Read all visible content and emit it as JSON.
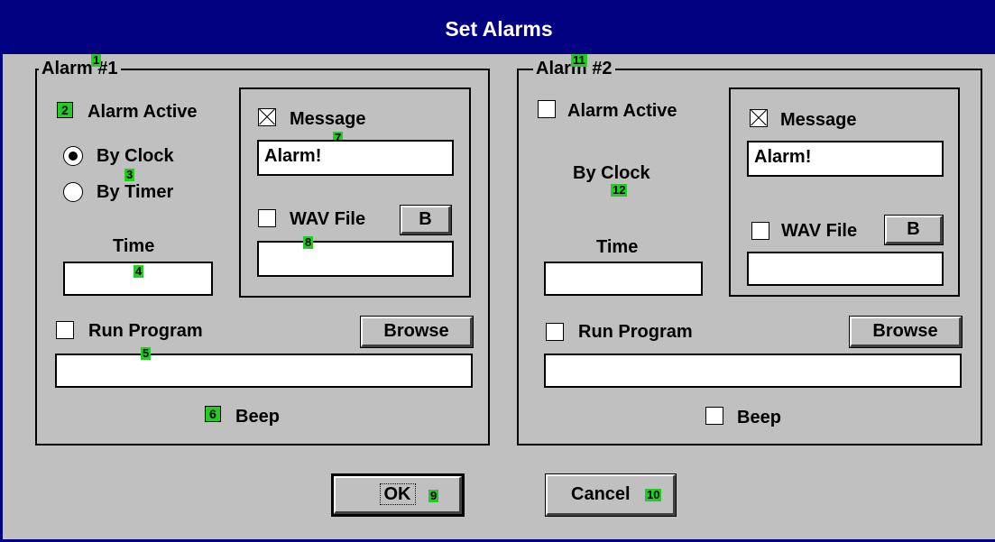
{
  "window": {
    "title": "Set Alarms"
  },
  "alarm1": {
    "group_label": "Alarm #1",
    "alarm_active_label": "Alarm Active",
    "by_clock_label": "By Clock",
    "by_timer_label": "By Timer",
    "time_label": "Time",
    "time_value": "",
    "message_label": "Message",
    "message_value": "Alarm!",
    "wav_file_label": "WAV File",
    "wav_browse_label": "B",
    "wav_value": "",
    "run_program_label": "Run Program",
    "browse_label": "Browse",
    "program_value": "",
    "beep_label": "Beep"
  },
  "alarm2": {
    "group_label": "Alarm #2",
    "alarm_active_label": "Alarm Active",
    "by_clock_label": "By Clock",
    "time_label": "Time",
    "time_value": "",
    "message_label": "Message",
    "message_value": "Alarm!",
    "wav_file_label": "WAV File",
    "wav_browse_label": "B",
    "wav_value": "",
    "run_program_label": "Run Program",
    "browse_label": "Browse",
    "program_value": "",
    "beep_label": "Beep"
  },
  "buttons": {
    "ok_label": "OK",
    "cancel_label": "Cancel"
  },
  "badges": [
    "1",
    "2",
    "3",
    "4",
    "5",
    "6",
    "7",
    "8",
    "9",
    "10",
    "11",
    "12"
  ],
  "colors": {
    "titlebar": "#000080",
    "dialog": "#c0c0c0",
    "badge": "#22cc22"
  }
}
